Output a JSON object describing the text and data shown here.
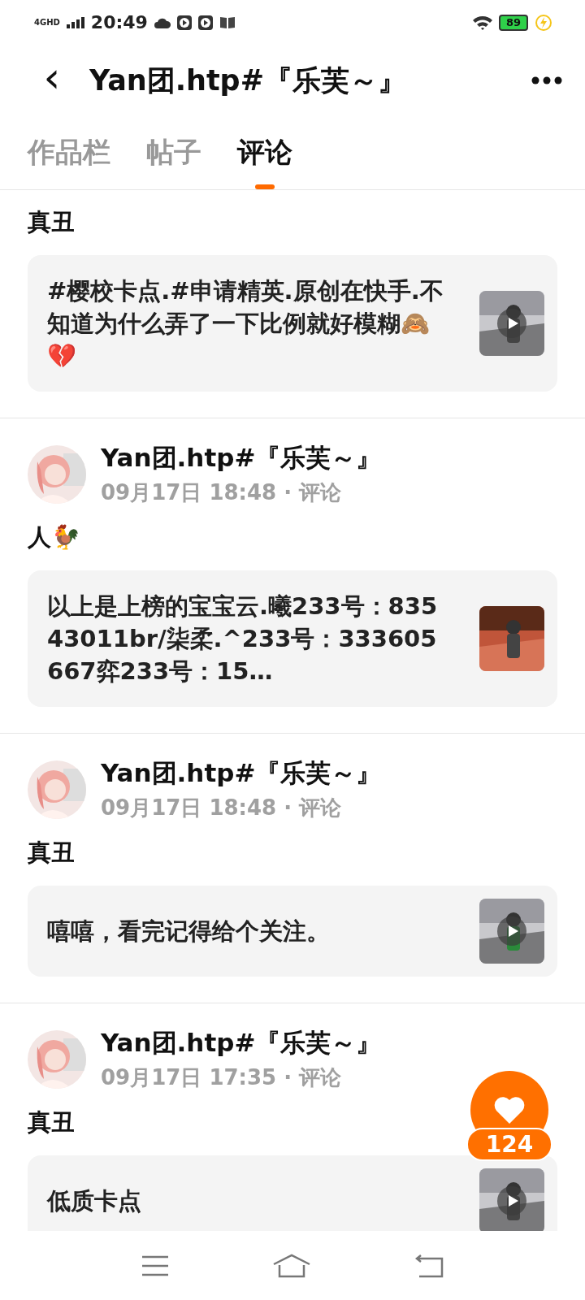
{
  "status_bar": {
    "network": "4GHD",
    "time": "20:49",
    "battery": "89",
    "charging": true
  },
  "header": {
    "back": "‹",
    "title": "Yan团.htp#『乐芙～』"
  },
  "tabs": [
    {
      "label": "作品栏",
      "selected": false
    },
    {
      "label": "帖子",
      "selected": false
    },
    {
      "label": "评论",
      "selected": true
    }
  ],
  "comments": [
    {
      "body": "真丑",
      "quote": "#樱校卡点.#申请精英.原创在快手.不知道为什么弄了一下比例就好模糊🙈💔",
      "thumb_video": true
    },
    {
      "author": "Yan团.htp#『乐芙～』",
      "time": "09月17日 18:48",
      "type": "评论",
      "body": "人🐓",
      "quote": "以上是上榜的宝宝云.曦233号：83543011br/柒柔.^233号：333605667弈233号：15…",
      "thumb_video": false
    },
    {
      "author": "Yan团.htp#『乐芙～』",
      "time": "09月17日 18:48",
      "type": "评论",
      "body": "真丑",
      "quote": "嘻嘻，看完记得给个关注。",
      "thumb_video": true
    },
    {
      "author": "Yan团.htp#『乐芙～』",
      "time": "09月17日 17:35",
      "type": "评论",
      "body": "真丑",
      "quote": "低质卡点",
      "thumb_video": true
    }
  ],
  "meta_separator": "·",
  "like_button": {
    "count": "124"
  }
}
